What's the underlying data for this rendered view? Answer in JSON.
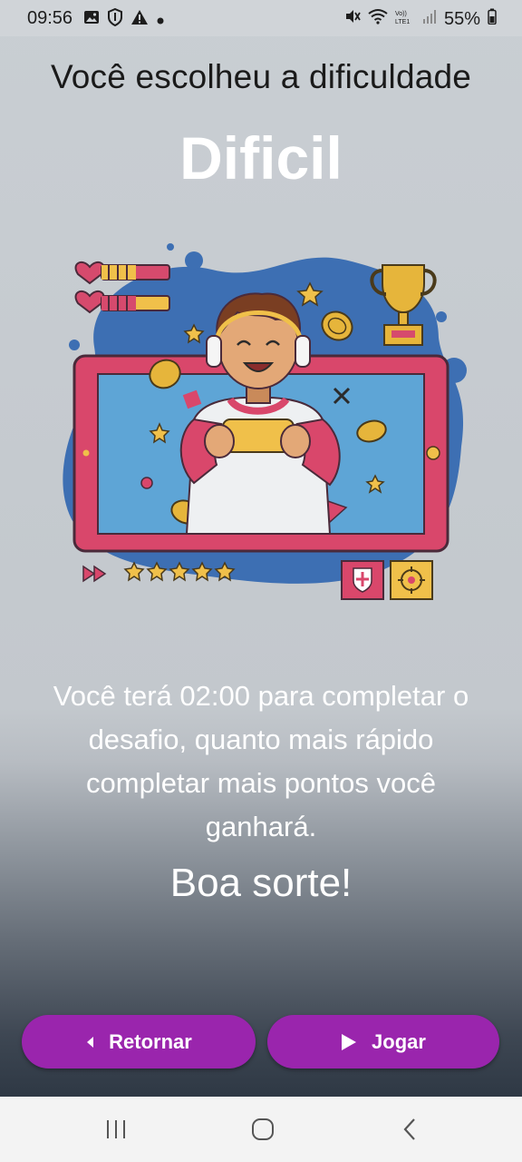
{
  "status_bar": {
    "time": "09:56",
    "battery": "55%",
    "icons": [
      "image-icon",
      "shield-icon",
      "warning-icon",
      "dot-icon",
      "mute-icon",
      "wifi-icon",
      "volte-icon",
      "signal-icon",
      "battery-icon"
    ]
  },
  "screen": {
    "heading": "Você escolheu a dificuldade",
    "difficulty": "Dificil",
    "description": "Você terá 02:00 para completar o desafio, quanto mais rápido completar mais pontos você ganhará.",
    "good_luck": "Boa sorte!"
  },
  "buttons": {
    "back_label": "Retornar",
    "play_label": "Jogar",
    "color": "#9a25ad"
  },
  "nav_bar": {
    "icons": [
      "recent-apps-icon",
      "home-icon",
      "back-icon"
    ]
  }
}
